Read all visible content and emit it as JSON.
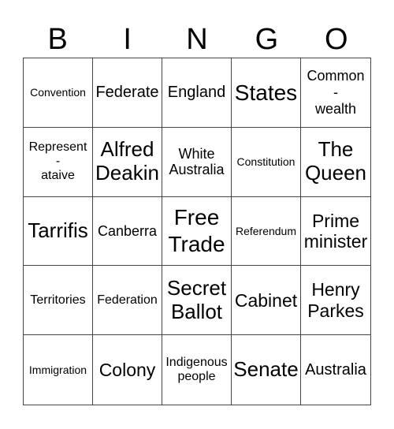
{
  "header": [
    "B",
    "I",
    "N",
    "G",
    "O"
  ],
  "cells": [
    "Convention",
    "Federate",
    "England",
    "States",
    "Common\n-\nwealth",
    "Represent\n-\nataive",
    "Alfred\nDeakin",
    "White\nAustralia",
    "Constitution",
    "The\nQueen",
    "Tarrifis",
    "Canberra",
    "Free\nTrade",
    "Referendum",
    "Prime\nminister",
    "Territories",
    "Federation",
    "Secret\nBallot",
    "Cabinet",
    "Henry\nParkes",
    "Immigration",
    "Colony",
    "Indigenous\npeople",
    "Senate",
    "Australia"
  ]
}
